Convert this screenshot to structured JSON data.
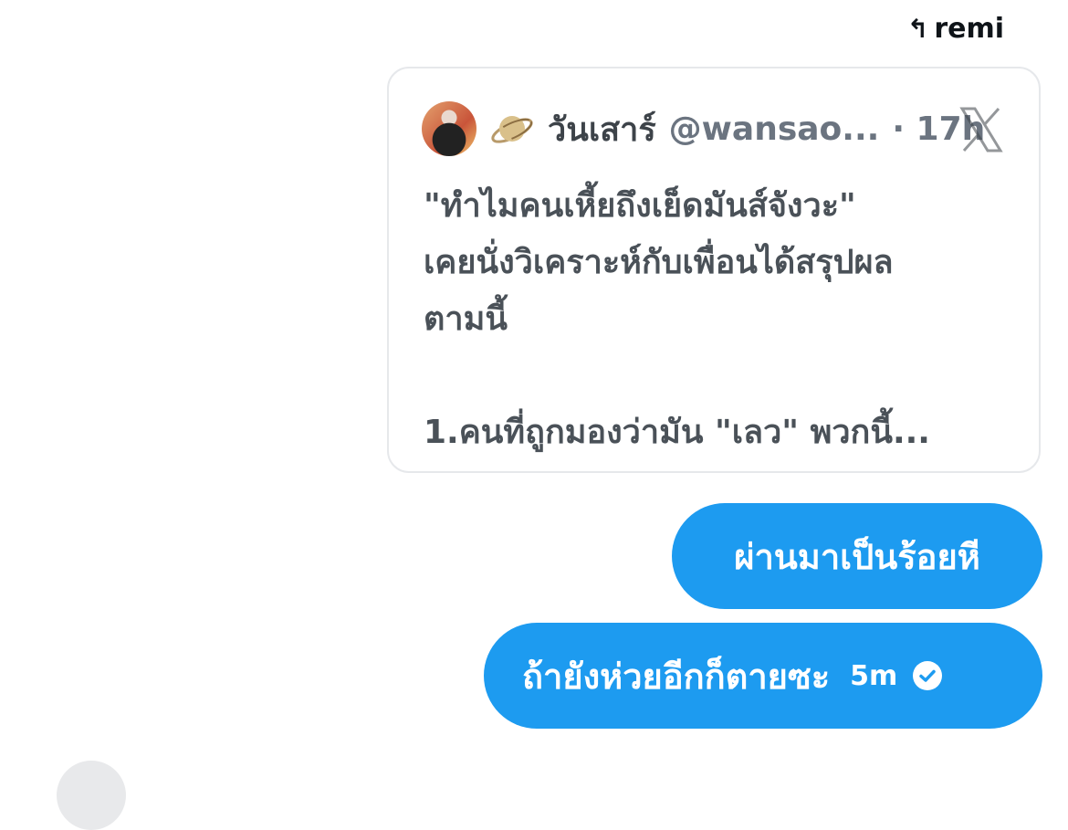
{
  "reply": {
    "icon": "reply-arrow-icon",
    "label": "remi"
  },
  "quote": {
    "avatar": "avatar",
    "emoji_icon": "saturn-icon",
    "name": "วันเสาร์",
    "handle": "@wansao...",
    "time": "· 17h",
    "platform_icon": "x-logo-icon",
    "body_lines": [
      "\"ทำไมคนเหี้ยถึงเย็ดมันส์จังวะ\"",
      "เคยนั่งวิเคราะห์กับเพื่อนได้สรุปผล",
      "ตามนี้",
      "",
      "1.คนที่ถูกมองว่ามัน \"เลว\" พวกนี้..."
    ]
  },
  "messages": [
    {
      "text": "ผ่านมาเป็นร้อยหี"
    },
    {
      "text": "ถ้ายังห่วยอีกก็ตายซะ",
      "time": "5m",
      "status_icon": "check-circle-icon"
    }
  ],
  "colors": {
    "bubble": "#1d9bf0",
    "text_dark": "#0f1419",
    "card_border": "#e6e8eb"
  }
}
